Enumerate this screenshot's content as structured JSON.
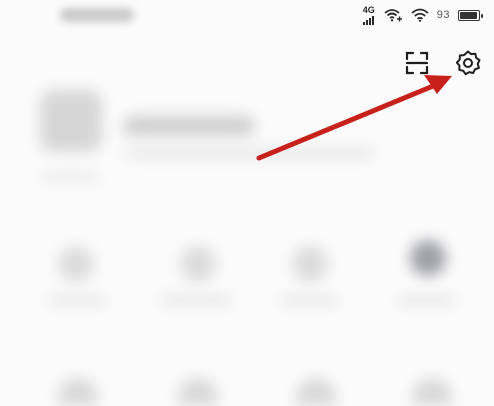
{
  "status_bar": {
    "network_label": "4G",
    "battery_percent": "93",
    "battery_level": 0.93,
    "wifi_icon": "wifi-icon",
    "wifi_plus_icon": "wifi-plus-icon"
  },
  "header": {
    "scan_icon": "scan-icon",
    "settings_icon": "gear-icon"
  },
  "annotation": {
    "arrow_color": "#c8201a",
    "target": "settings-button"
  }
}
